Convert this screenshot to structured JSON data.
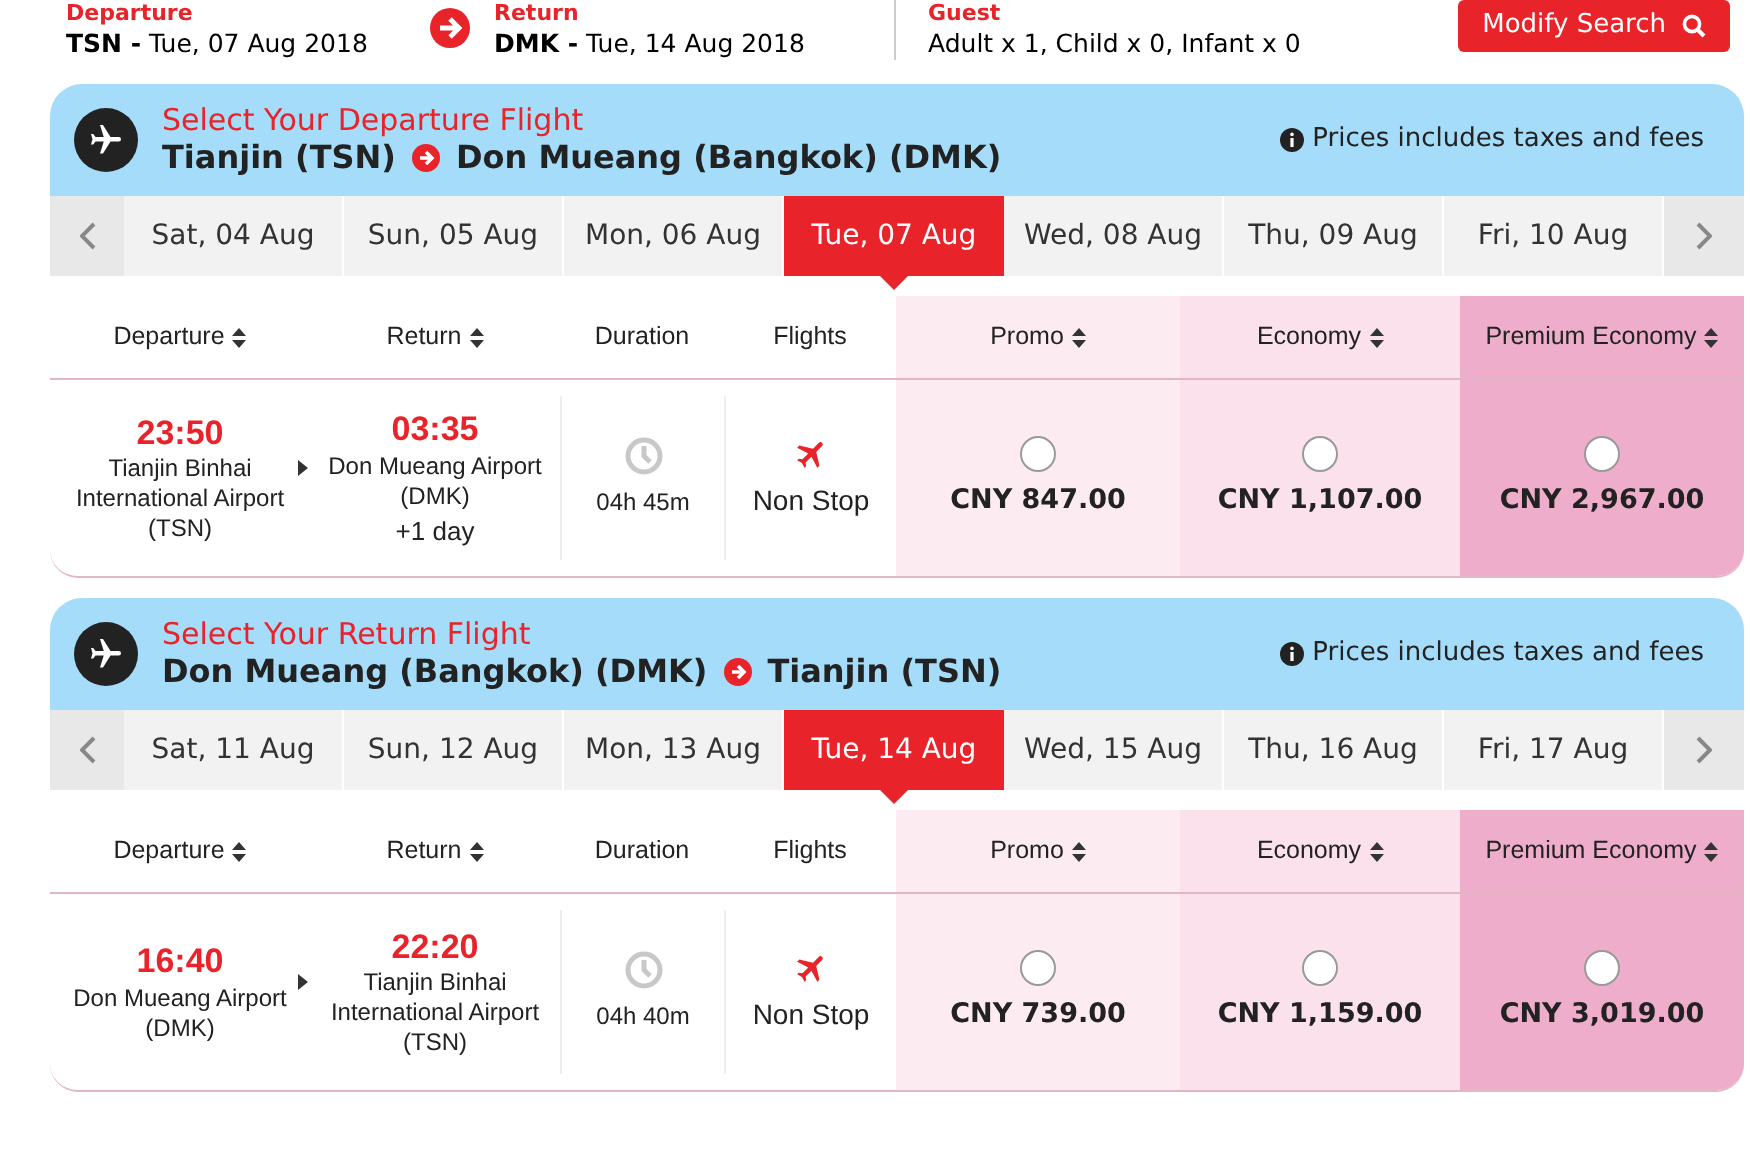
{
  "search_summary": {
    "departure": {
      "label": "Departure",
      "code": "TSN -",
      "date": "Tue, 07 Aug 2018"
    },
    "return": {
      "label": "Return",
      "code": "DMK -",
      "date": "Tue, 14 Aug 2018"
    },
    "guest": {
      "label": "Guest",
      "text": "Adult x 1, Child x 0, Infant x 0"
    },
    "button": "Modify Search"
  },
  "sections": [
    {
      "prompt": "Select Your Departure Flight",
      "origin": "Tianjin (TSN)",
      "destination": "Don Mueang (Bangkok) (DMK)",
      "note": "Prices includes taxes and fees",
      "dates": [
        {
          "label": "Sat, 04 Aug",
          "selected": false
        },
        {
          "label": "Sun, 05 Aug",
          "selected": false
        },
        {
          "label": "Mon, 06 Aug",
          "selected": false
        },
        {
          "label": "Tue, 07 Aug",
          "selected": true
        },
        {
          "label": "Wed, 08 Aug",
          "selected": false
        },
        {
          "label": "Thu, 09 Aug",
          "selected": false
        },
        {
          "label": "Fri, 10 Aug",
          "selected": false
        }
      ],
      "columns": [
        "Departure",
        "Return",
        "Duration",
        "Flights",
        "Promo",
        "Economy",
        "Premium Economy"
      ],
      "flight": {
        "depart_time": "23:50",
        "depart_airport": "Tianjin Binhai International Airport (TSN)",
        "arrive_time": "03:35",
        "arrive_airport": "Don Mueang Airport (DMK)",
        "day_offset": "+1 day",
        "duration": "04h 45m",
        "stops": "Non Stop",
        "fares": [
          {
            "price": "CNY 847.00",
            "selected": false
          },
          {
            "price": "CNY 1,107.00",
            "selected": false
          },
          {
            "price": "CNY 2,967.00",
            "selected": false
          }
        ]
      }
    },
    {
      "prompt": "Select Your Return Flight",
      "origin": "Don Mueang (Bangkok) (DMK)",
      "destination": "Tianjin (TSN)",
      "note": "Prices includes taxes and fees",
      "dates": [
        {
          "label": "Sat, 11 Aug",
          "selected": false
        },
        {
          "label": "Sun, 12 Aug",
          "selected": false
        },
        {
          "label": "Mon, 13 Aug",
          "selected": false
        },
        {
          "label": "Tue, 14 Aug",
          "selected": true
        },
        {
          "label": "Wed, 15 Aug",
          "selected": false
        },
        {
          "label": "Thu, 16 Aug",
          "selected": false
        },
        {
          "label": "Fri, 17 Aug",
          "selected": false
        }
      ],
      "columns": [
        "Departure",
        "Return",
        "Duration",
        "Flights",
        "Promo",
        "Economy",
        "Premium Economy"
      ],
      "flight": {
        "depart_time": "16:40",
        "depart_airport": "Don Mueang Airport (DMK)",
        "arrive_time": "22:20",
        "arrive_airport": "Tianjin Binhai International Airport (TSN)",
        "duration": "04h 40m",
        "stops": "Non Stop",
        "fares": [
          {
            "price": "CNY 739.00",
            "selected": false
          },
          {
            "price": "CNY 1,159.00",
            "selected": false
          },
          {
            "price": "CNY 3,019.00",
            "selected": false
          }
        ]
      }
    }
  ]
}
